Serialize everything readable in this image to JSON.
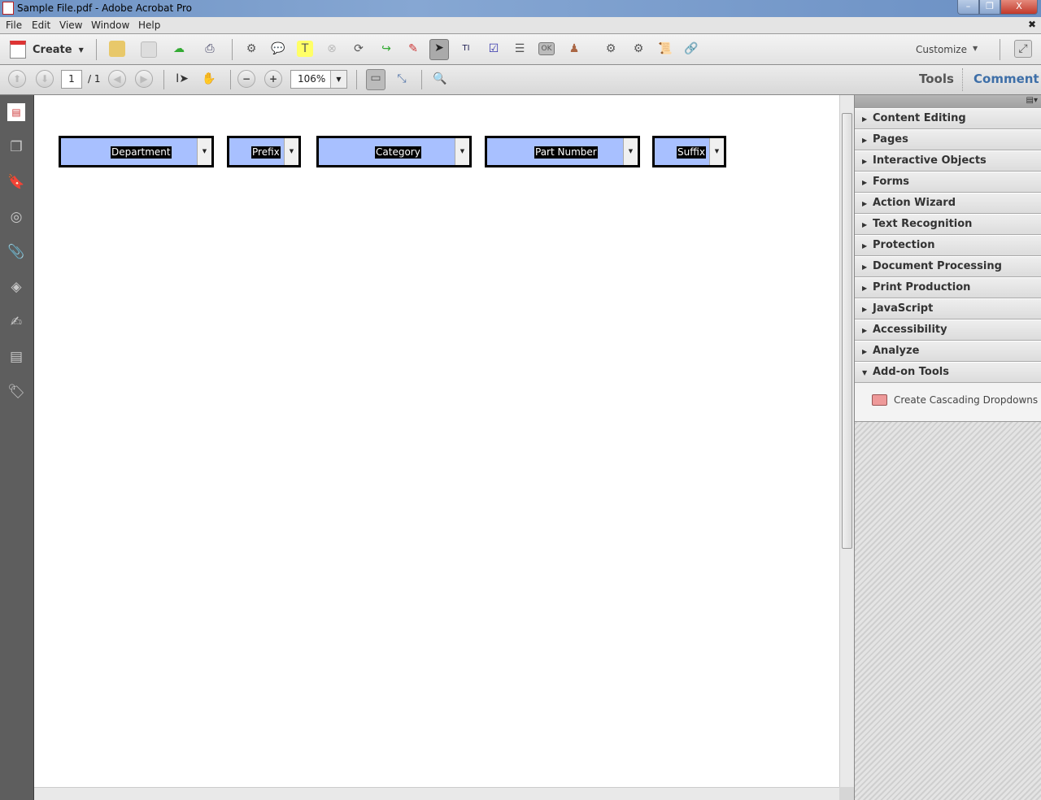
{
  "window": {
    "title": "Sample File.pdf - Adobe Acrobat Pro",
    "min": "–",
    "restore": "❐",
    "close": "X"
  },
  "menu": [
    "File",
    "Edit",
    "View",
    "Window",
    "Help"
  ],
  "menu_close": "✖",
  "toolbar": {
    "create_label": "Create",
    "customize_label": "Customize"
  },
  "nav": {
    "page": "1",
    "page_total": "/ 1",
    "zoom": "106%"
  },
  "tabs": {
    "tools": "Tools",
    "comment": "Comment"
  },
  "fields": [
    {
      "label": "Department"
    },
    {
      "label": "Prefix"
    },
    {
      "label": "Category"
    },
    {
      "label": "Part Number"
    },
    {
      "label": "Suffix"
    }
  ],
  "panel": {
    "sections": [
      "Content Editing",
      "Pages",
      "Interactive Objects",
      "Forms",
      "Action Wizard",
      "Text Recognition",
      "Protection",
      "Document Processing",
      "Print Production",
      "JavaScript",
      "Accessibility",
      "Analyze",
      "Add-on Tools"
    ],
    "addon_tool": "Create Cascading Dropdowns"
  },
  "colors": {
    "field_bg": "#a8c0ff",
    "comment_tab": "#3e6fa8"
  }
}
